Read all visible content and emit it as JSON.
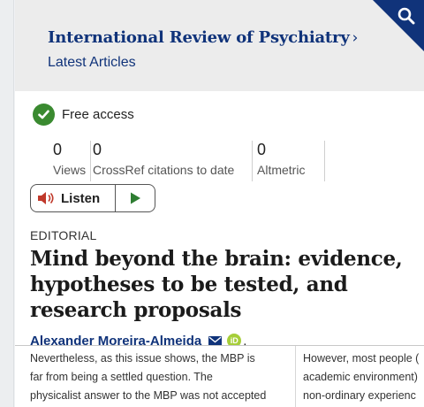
{
  "header": {
    "journal_title": "International Review of Psychiatry",
    "chevron": "›",
    "latest_articles": "Latest Articles",
    "search_icon": "search-icon",
    "accent_color": "#10337a"
  },
  "access": {
    "label": "Free access",
    "icon": "check-circle-icon",
    "color": "#3a8a30"
  },
  "metrics": [
    {
      "value": "0",
      "label": "Views"
    },
    {
      "value": "0",
      "label": "CrossRef citations to date"
    },
    {
      "value": "0",
      "label": "Altmetric"
    }
  ],
  "listen": {
    "label": "Listen",
    "speaker_icon": "speaker-icon",
    "play_icon": "play-icon"
  },
  "article": {
    "type": "EDITORIAL",
    "title": "Mind beyond the brain: evidence, hypotheses to be tested, and research proposals",
    "author": "Alexander Moreira-Almeida",
    "author_suffix": ".",
    "mail_icon": "envelope-icon",
    "orcid_icon": "orcid-icon",
    "orcid_text": "iD"
  },
  "preview": {
    "left_lines": [
      "Nevertheless, as this issue shows, the MBP is",
      "far from being a settled question. The",
      "physicalist answer to the MBP was not accepted"
    ],
    "right_lines": [
      "However, most people (",
      "academic environment)",
      "non-ordinary experienc"
    ]
  }
}
